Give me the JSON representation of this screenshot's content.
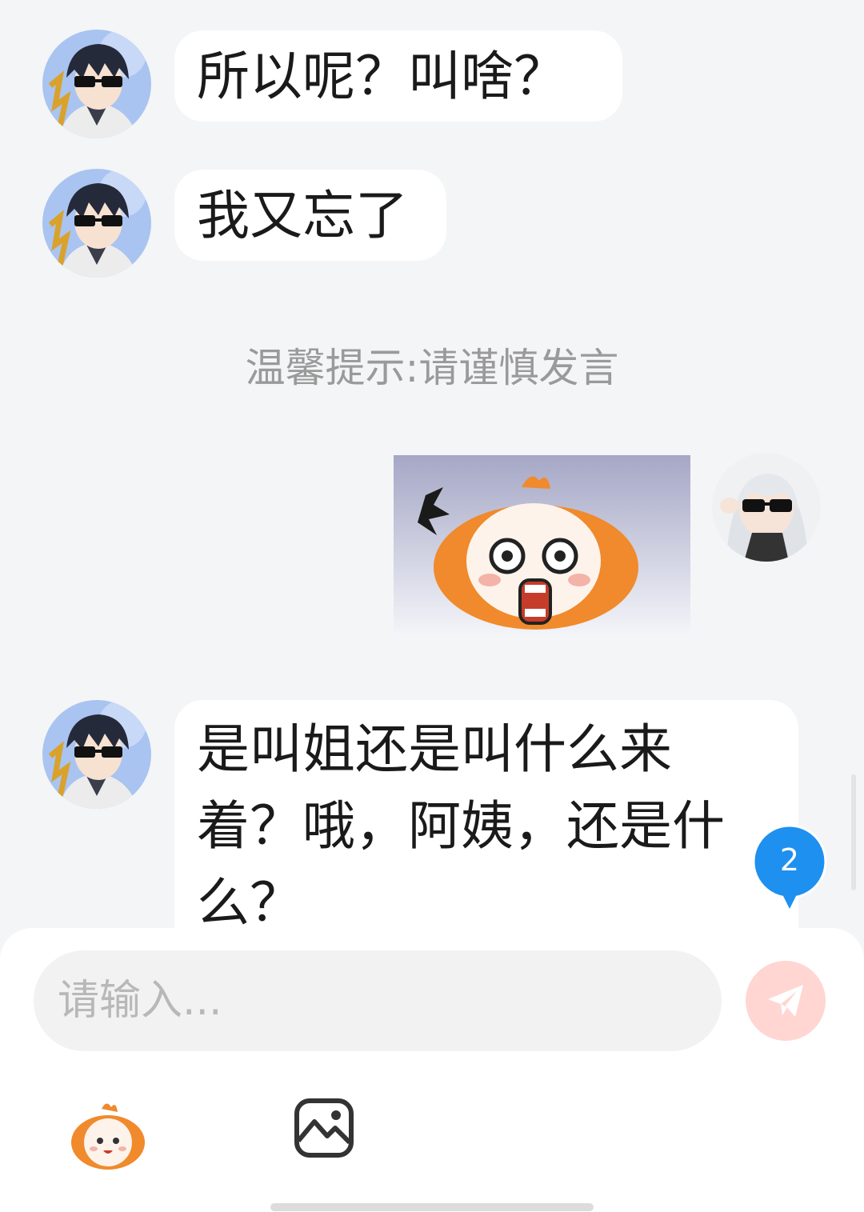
{
  "messages": [
    {
      "sender": "other",
      "text": "所以呢？叫啥？"
    },
    {
      "sender": "other",
      "text": "我又忘了"
    },
    {
      "sender": "self",
      "type": "sticker",
      "sticker": "angry-orange-character-sticker"
    },
    {
      "sender": "other",
      "text": "是叫姐还是叫什么来着？哦，阿姨，还是什么？"
    }
  ],
  "notice": "温馨提示:请谨慎发言",
  "unread_badge": "2",
  "composer": {
    "placeholder": "请输入...",
    "send_icon": "paper-plane-icon",
    "emoji_icon": "orange-mascot-emoji-icon",
    "image_icon": "image-icon"
  },
  "colors": {
    "background": "#f4f5f7",
    "bubble": "#ffffff",
    "notice_text": "#9a9a9a",
    "badge": "#1e90f0",
    "send_button": "#ffd6d2",
    "mascot_orange": "#f08a2c"
  }
}
